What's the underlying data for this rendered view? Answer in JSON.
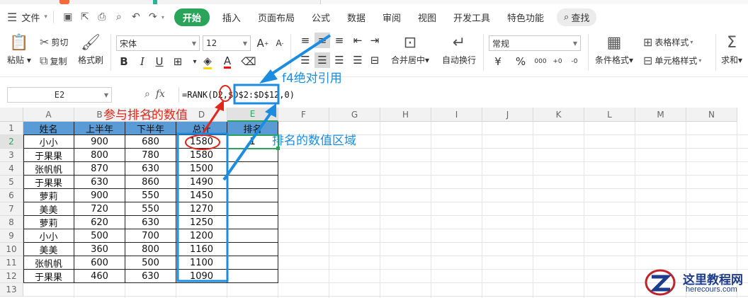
{
  "menubar": {
    "file_label": "文件",
    "tabs": [
      {
        "label": "开始",
        "active": true
      },
      {
        "label": "插入"
      },
      {
        "label": "页面布局"
      },
      {
        "label": "公式"
      },
      {
        "label": "数据"
      },
      {
        "label": "审阅"
      },
      {
        "label": "视图"
      },
      {
        "label": "开发工具"
      },
      {
        "label": "特色功能"
      }
    ],
    "search_label": "查找"
  },
  "ribbon": {
    "paste": "粘贴",
    "cut": "剪切",
    "copy": "复制",
    "format_painter": "格式刷",
    "font_name": "宋体",
    "font_size": "12",
    "merge_center": "合并居中",
    "wrap_text": "自动换行",
    "number_format": "常规",
    "cond_format": "条件格式",
    "table_style": "表格样式",
    "cell_style": "单元格样式",
    "sum": "求和",
    "bold_glyph": "B",
    "italic_glyph": "I",
    "underline_glyph": "U",
    "percent_glyph": "%",
    "currency_glyph": "¥",
    "grow_glyph": "A",
    "shrink_glyph": "A",
    "font_color_glyph": "A"
  },
  "formula_bar": {
    "cell_ref": "E2",
    "fx": "fx",
    "formula": "=RANK(D2,$D$2:$D$12,0)"
  },
  "sheet": {
    "columns": [
      "A",
      "B",
      "C",
      "D",
      "E",
      "F",
      "G",
      "H",
      "I",
      "J",
      "K",
      "L",
      "M",
      "N"
    ],
    "rows": [
      "1",
      "2",
      "3",
      "4",
      "5",
      "6",
      "7",
      "8",
      "9",
      "10",
      "11",
      "12",
      "13"
    ],
    "active_cell": "E2",
    "headers": [
      "姓名",
      "上半年",
      "下半年",
      "总计",
      "排名"
    ],
    "data": [
      [
        "小小",
        "900",
        "680",
        "1580",
        "1"
      ],
      [
        "于果果",
        "800",
        "780",
        "1580",
        ""
      ],
      [
        "张帆帆",
        "870",
        "630",
        "1500",
        ""
      ],
      [
        "于果果",
        "630",
        "860",
        "1490",
        ""
      ],
      [
        "萝莉",
        "900",
        "550",
        "1450",
        ""
      ],
      [
        "美美",
        "720",
        "550",
        "1270",
        ""
      ],
      [
        "萝莉",
        "620",
        "630",
        "1250",
        ""
      ],
      [
        "小小",
        "500",
        "700",
        "1200",
        ""
      ],
      [
        "美美",
        "360",
        "800",
        "1160",
        ""
      ],
      [
        "张帆帆",
        "600",
        "500",
        "1100",
        ""
      ],
      [
        "于果果",
        "460",
        "630",
        "1090",
        ""
      ]
    ]
  },
  "annotations": {
    "value_label": "参与排名的数值",
    "abs_ref_label": "f4绝对引用",
    "range_label": "排名的数值区域",
    "red_color": "#e1261c",
    "blue_color": "#1a8de0"
  },
  "watermark": {
    "title": "这里教程网",
    "url": "herecours.com"
  },
  "colors": {
    "accent_green": "#2aa45a",
    "header_fill": "#5b9bd5"
  }
}
